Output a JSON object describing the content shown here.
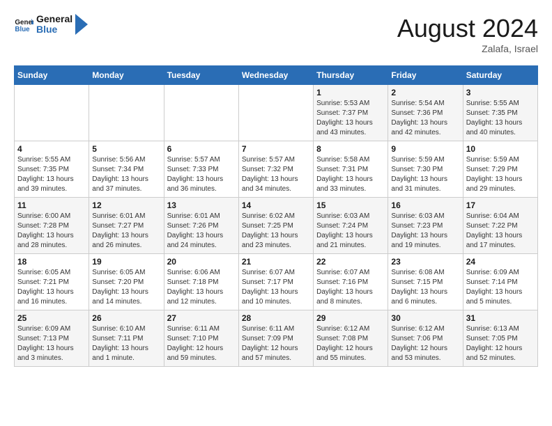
{
  "header": {
    "logo_text_general": "General",
    "logo_text_blue": "Blue",
    "month_year": "August 2024",
    "location": "Zalafa, Israel"
  },
  "days_of_week": [
    "Sunday",
    "Monday",
    "Tuesday",
    "Wednesday",
    "Thursday",
    "Friday",
    "Saturday"
  ],
  "weeks": [
    {
      "days": [
        {
          "num": "",
          "info": ""
        },
        {
          "num": "",
          "info": ""
        },
        {
          "num": "",
          "info": ""
        },
        {
          "num": "",
          "info": ""
        },
        {
          "num": "1",
          "info": "Sunrise: 5:53 AM\nSunset: 7:37 PM\nDaylight: 13 hours and 43 minutes."
        },
        {
          "num": "2",
          "info": "Sunrise: 5:54 AM\nSunset: 7:36 PM\nDaylight: 13 hours and 42 minutes."
        },
        {
          "num": "3",
          "info": "Sunrise: 5:55 AM\nSunset: 7:35 PM\nDaylight: 13 hours and 40 minutes."
        }
      ]
    },
    {
      "days": [
        {
          "num": "4",
          "info": "Sunrise: 5:55 AM\nSunset: 7:35 PM\nDaylight: 13 hours and 39 minutes."
        },
        {
          "num": "5",
          "info": "Sunrise: 5:56 AM\nSunset: 7:34 PM\nDaylight: 13 hours and 37 minutes."
        },
        {
          "num": "6",
          "info": "Sunrise: 5:57 AM\nSunset: 7:33 PM\nDaylight: 13 hours and 36 minutes."
        },
        {
          "num": "7",
          "info": "Sunrise: 5:57 AM\nSunset: 7:32 PM\nDaylight: 13 hours and 34 minutes."
        },
        {
          "num": "8",
          "info": "Sunrise: 5:58 AM\nSunset: 7:31 PM\nDaylight: 13 hours and 33 minutes."
        },
        {
          "num": "9",
          "info": "Sunrise: 5:59 AM\nSunset: 7:30 PM\nDaylight: 13 hours and 31 minutes."
        },
        {
          "num": "10",
          "info": "Sunrise: 5:59 AM\nSunset: 7:29 PM\nDaylight: 13 hours and 29 minutes."
        }
      ]
    },
    {
      "days": [
        {
          "num": "11",
          "info": "Sunrise: 6:00 AM\nSunset: 7:28 PM\nDaylight: 13 hours and 28 minutes."
        },
        {
          "num": "12",
          "info": "Sunrise: 6:01 AM\nSunset: 7:27 PM\nDaylight: 13 hours and 26 minutes."
        },
        {
          "num": "13",
          "info": "Sunrise: 6:01 AM\nSunset: 7:26 PM\nDaylight: 13 hours and 24 minutes."
        },
        {
          "num": "14",
          "info": "Sunrise: 6:02 AM\nSunset: 7:25 PM\nDaylight: 13 hours and 23 minutes."
        },
        {
          "num": "15",
          "info": "Sunrise: 6:03 AM\nSunset: 7:24 PM\nDaylight: 13 hours and 21 minutes."
        },
        {
          "num": "16",
          "info": "Sunrise: 6:03 AM\nSunset: 7:23 PM\nDaylight: 13 hours and 19 minutes."
        },
        {
          "num": "17",
          "info": "Sunrise: 6:04 AM\nSunset: 7:22 PM\nDaylight: 13 hours and 17 minutes."
        }
      ]
    },
    {
      "days": [
        {
          "num": "18",
          "info": "Sunrise: 6:05 AM\nSunset: 7:21 PM\nDaylight: 13 hours and 16 minutes."
        },
        {
          "num": "19",
          "info": "Sunrise: 6:05 AM\nSunset: 7:20 PM\nDaylight: 13 hours and 14 minutes."
        },
        {
          "num": "20",
          "info": "Sunrise: 6:06 AM\nSunset: 7:18 PM\nDaylight: 13 hours and 12 minutes."
        },
        {
          "num": "21",
          "info": "Sunrise: 6:07 AM\nSunset: 7:17 PM\nDaylight: 13 hours and 10 minutes."
        },
        {
          "num": "22",
          "info": "Sunrise: 6:07 AM\nSunset: 7:16 PM\nDaylight: 13 hours and 8 minutes."
        },
        {
          "num": "23",
          "info": "Sunrise: 6:08 AM\nSunset: 7:15 PM\nDaylight: 13 hours and 6 minutes."
        },
        {
          "num": "24",
          "info": "Sunrise: 6:09 AM\nSunset: 7:14 PM\nDaylight: 13 hours and 5 minutes."
        }
      ]
    },
    {
      "days": [
        {
          "num": "25",
          "info": "Sunrise: 6:09 AM\nSunset: 7:13 PM\nDaylight: 13 hours and 3 minutes."
        },
        {
          "num": "26",
          "info": "Sunrise: 6:10 AM\nSunset: 7:11 PM\nDaylight: 13 hours and 1 minute."
        },
        {
          "num": "27",
          "info": "Sunrise: 6:11 AM\nSunset: 7:10 PM\nDaylight: 12 hours and 59 minutes."
        },
        {
          "num": "28",
          "info": "Sunrise: 6:11 AM\nSunset: 7:09 PM\nDaylight: 12 hours and 57 minutes."
        },
        {
          "num": "29",
          "info": "Sunrise: 6:12 AM\nSunset: 7:08 PM\nDaylight: 12 hours and 55 minutes."
        },
        {
          "num": "30",
          "info": "Sunrise: 6:12 AM\nSunset: 7:06 PM\nDaylight: 12 hours and 53 minutes."
        },
        {
          "num": "31",
          "info": "Sunrise: 6:13 AM\nSunset: 7:05 PM\nDaylight: 12 hours and 52 minutes."
        }
      ]
    }
  ]
}
